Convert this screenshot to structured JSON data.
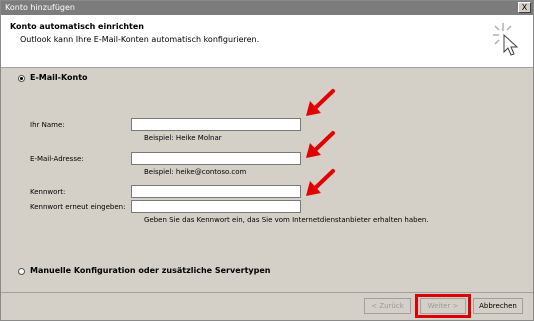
{
  "window": {
    "title": "Konto hinzufügen",
    "close_glyph": "X"
  },
  "header": {
    "title": "Konto automatisch einrichten",
    "subtitle": "Outlook kann Ihre E-Mail-Konten automatisch konfigurieren."
  },
  "options": {
    "email_account": "E-Mail-Konto",
    "manual": "Manuelle Konfiguration oder zusätzliche Servertypen"
  },
  "fields": {
    "name_label": "Ihr Name:",
    "name_value": "",
    "name_hint": "Beispiel: Heike Molnar",
    "email_label": "E-Mail-Adresse:",
    "email_value": "",
    "email_hint": "Beispiel: heike@contoso.com",
    "password_label": "Kennwort:",
    "password_value": "",
    "password_repeat_label": "Kennwort erneut eingeben:",
    "password_repeat_value": "",
    "password_hint": "Geben Sie das Kennwort ein, das Sie vom Internetdienstanbieter erhalten haben."
  },
  "buttons": {
    "back": "< Zurück",
    "next": "Weiter >",
    "cancel": "Abbrechen"
  },
  "colors": {
    "annotation_red": "#e00000"
  }
}
